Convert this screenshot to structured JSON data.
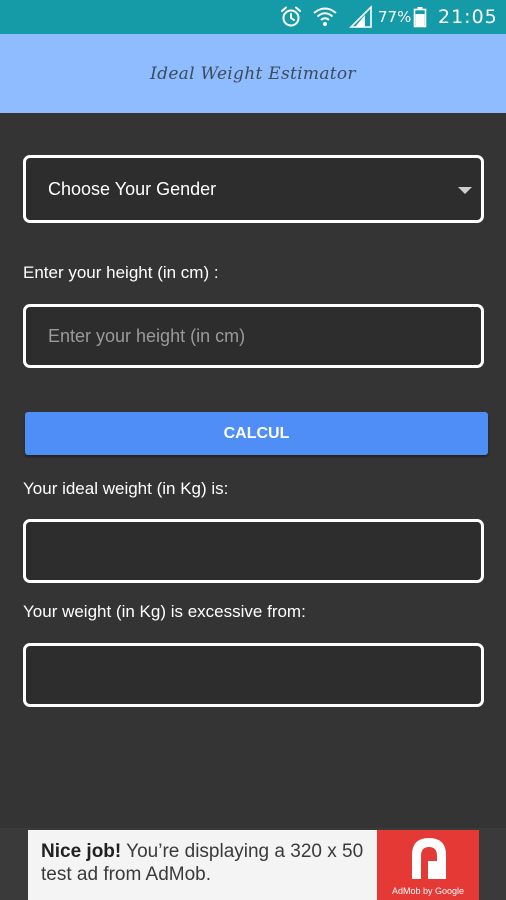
{
  "status_bar": {
    "battery_percent": "77%",
    "time": "21:05",
    "icons": [
      "alarm-icon",
      "wifi-icon",
      "signal-icon",
      "battery-icon"
    ],
    "background": "#159aa8"
  },
  "app_bar": {
    "title": "Ideal Weight Estimator",
    "background": "#8ebcff"
  },
  "form": {
    "gender_select": {
      "selected": "Choose Your Gender"
    },
    "height_label": "Enter your height (in cm) :",
    "height_input": {
      "placeholder": "Enter your height (in cm)",
      "value": ""
    },
    "calc_button_label": "CALCUL",
    "ideal_label": "Your ideal weight (in Kg) is:",
    "ideal_value": "",
    "excess_label": "Your weight (in Kg) is excessive from:",
    "excess_value": ""
  },
  "colors": {
    "accent": "#4f8ef7",
    "background": "#343434",
    "ad_logo": "#e53935"
  },
  "ad": {
    "headline": "Nice job!",
    "body": "You’re displaying a 320 x 50 test ad from AdMob.",
    "brand": "AdMob by Google"
  }
}
